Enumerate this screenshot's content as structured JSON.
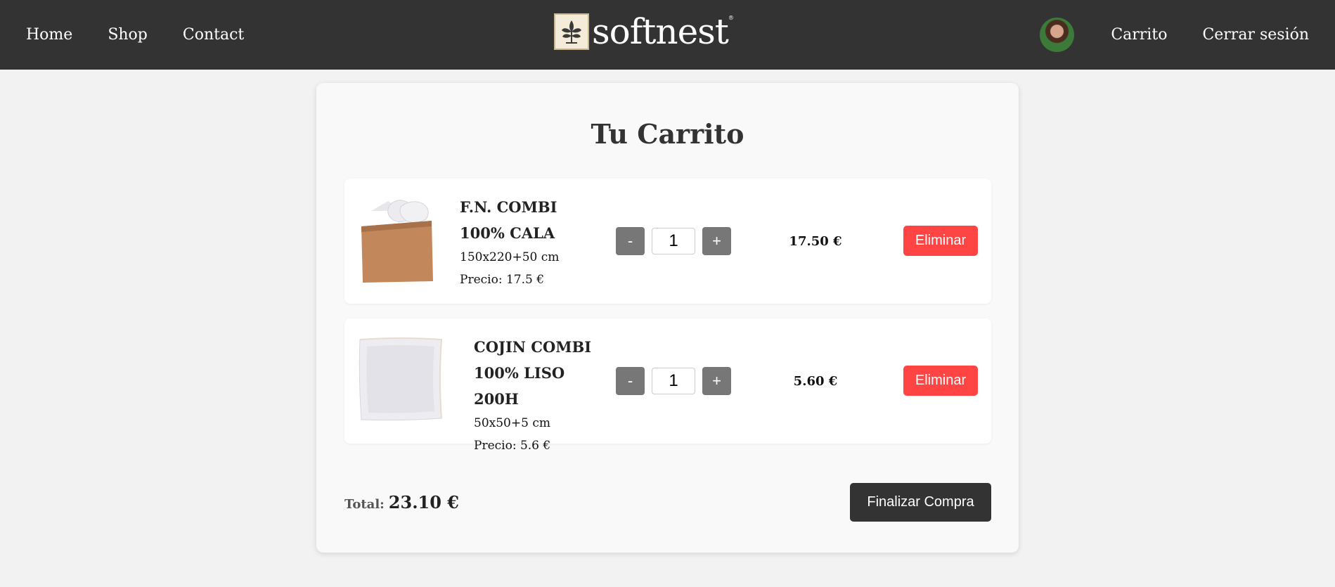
{
  "nav": {
    "home": "Home",
    "shop": "Shop",
    "contact": "Contact",
    "logo_text": "softnest",
    "logo_reg": "®",
    "cart": "Carrito",
    "logout": "Cerrar sesión"
  },
  "cart": {
    "title": "Tu Carrito",
    "items": [
      {
        "name": "F.N. COMBI 100% CALA",
        "size": "150x220+50 cm",
        "price_label": "Precio: 17.5 €",
        "quantity": "1",
        "line_total": "17.50 €",
        "decrement": "-",
        "increment": "+",
        "remove": "Eliminar"
      },
      {
        "name": "COJIN COMBI 100% LISO 200H",
        "size": "50x50+5 cm",
        "price_label": "Precio: 5.6 €",
        "quantity": "1",
        "line_total": "5.60 €",
        "decrement": "-",
        "increment": "+",
        "remove": "Eliminar"
      }
    ],
    "total_label": "Total:",
    "total_value": "23.10 €",
    "checkout": "Finalizar Compra"
  },
  "colors": {
    "header_bg": "#333333",
    "remove_bg": "#ff4444",
    "checkout_bg": "#333333",
    "qty_btn_bg": "#777777"
  }
}
